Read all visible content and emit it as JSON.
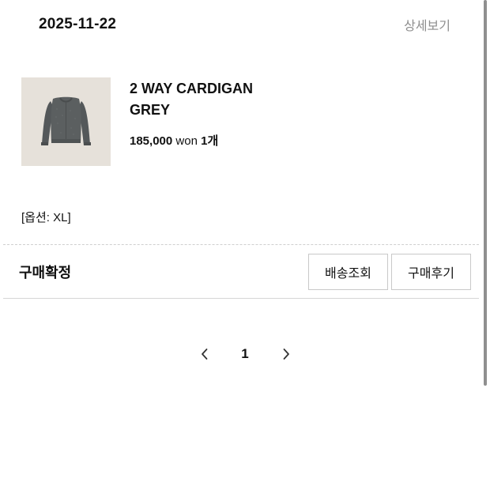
{
  "order": {
    "date": "2025-11-22",
    "detail_link": "상세보기"
  },
  "product": {
    "name_line1": "2 WAY CARDIGAN",
    "name_line2": "GREY",
    "price": "185,000",
    "currency": "won",
    "quantity": "1개",
    "option": "[옵션: XL]",
    "thumbnail_icon": "grey-cardigan-product-image"
  },
  "status": {
    "label": "구매확정"
  },
  "actions": {
    "shipping_label": "배송조회",
    "review_label": "구매후기"
  },
  "pagination": {
    "current_page": "1"
  },
  "colors": {
    "text": "#111111",
    "muted": "#8e8e8e",
    "border": "#c9c9c9",
    "thumb_bg": "#e6e1da",
    "sweater": "#595d5e"
  }
}
